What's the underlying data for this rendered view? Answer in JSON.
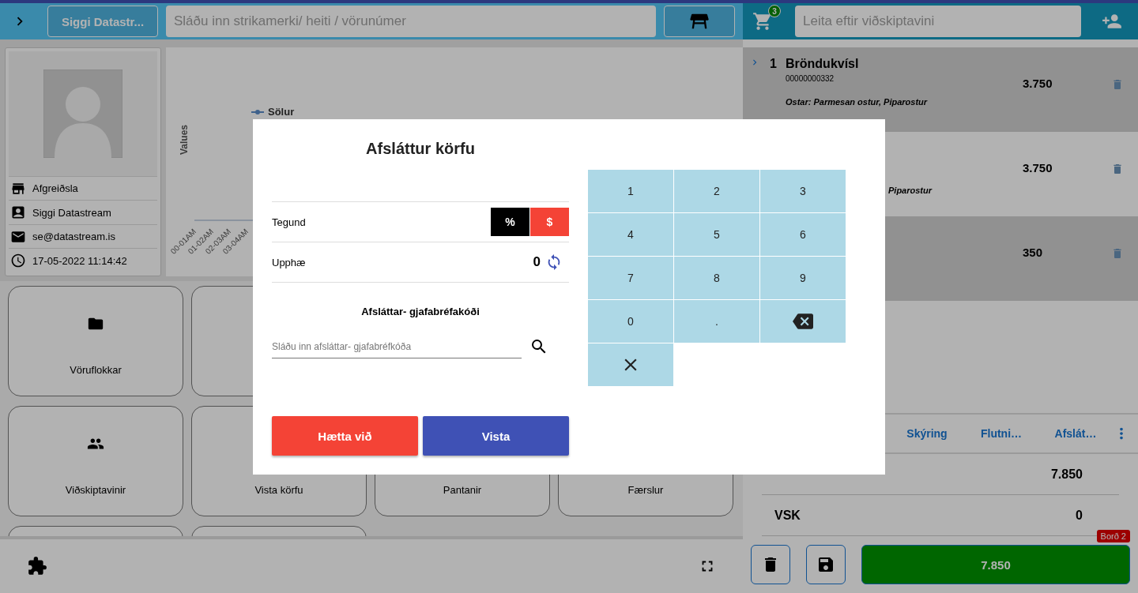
{
  "topbar": {
    "user_button": "Siggi Datastr...",
    "search": {
      "placeholder": "Sláðu inn strikamerki/ heiti / vörunúmer"
    },
    "cart_count": "3",
    "customer_search": {
      "placeholder": "Leita eftir viðskiptavini"
    }
  },
  "profile": {
    "rows": [
      {
        "kind": "store",
        "text": "Afgreiðsla"
      },
      {
        "kind": "person",
        "text": "Siggi Datastream"
      },
      {
        "kind": "email",
        "text": "se@datastream.is"
      },
      {
        "kind": "clock",
        "text": "17-05-2022 11:14:42"
      }
    ]
  },
  "chart": {
    "legend": "Sölur",
    "ylabel": "Values",
    "xlabels": [
      "00-01AM",
      "01-02AM",
      "02-03AM",
      "03-04AM"
    ]
  },
  "tile_rows": [
    [
      {
        "kind": "folder",
        "label": "Vöruflokkar"
      },
      {
        "kind": "plain"
      }
    ],
    [
      {
        "kind": "people",
        "label": "Viðskiptavinir"
      },
      {
        "kind": "plain",
        "label": "Vista körfu"
      },
      {
        "kind": "plain",
        "label": "Pantanir"
      },
      {
        "kind": "plain",
        "label": "Færslur"
      }
    ],
    [
      {
        "kind": "plain"
      },
      {
        "kind": "plain"
      }
    ]
  ],
  "cart": {
    "items": [
      {
        "number": "1",
        "name": "Bröndukvísl",
        "code": "00000000332",
        "note": "Ostar: Parmesan ostur, Piparostur",
        "price": "3.750"
      },
      {
        "note": "Piparostur",
        "price": "3.750"
      },
      {
        "price": "350"
      }
    ],
    "tabs": [
      "Skýring",
      "Flutni…",
      "Afslát…"
    ],
    "summary": [
      {
        "value": "7.850"
      },
      {
        "label": "VSK",
        "value": "0"
      }
    ],
    "table_badge": "Borð 2",
    "total": "7.850"
  },
  "modal": {
    "title": "Afsláttur körfu",
    "type_label": "Tegund",
    "type_options": [
      {
        "label": "%",
        "selected": false
      },
      {
        "label": "$",
        "selected": true
      }
    ],
    "amount_label": "Upphæ",
    "amount": "0",
    "code_heading": "Afsláttar- gjafabréfakóði",
    "code_field": {
      "placeholder": "Sláðu inn afsláttar- gjafabréfkóða"
    },
    "keypad": [
      {
        "kind": "digit",
        "label": "1"
      },
      {
        "kind": "digit",
        "label": "2"
      },
      {
        "kind": "digit",
        "label": "3"
      },
      {
        "kind": "digit",
        "label": "4"
      },
      {
        "kind": "digit",
        "label": "5"
      },
      {
        "kind": "digit",
        "label": "6"
      },
      {
        "kind": "digit",
        "label": "7"
      },
      {
        "kind": "digit",
        "label": "8"
      },
      {
        "kind": "digit",
        "label": "9"
      },
      {
        "kind": "digit",
        "label": "0"
      },
      {
        "kind": "digit",
        "label": "."
      },
      {
        "kind": "backspace"
      },
      {
        "kind": "clear"
      }
    ],
    "cancel": "Hætta við",
    "save": "Vista"
  }
}
